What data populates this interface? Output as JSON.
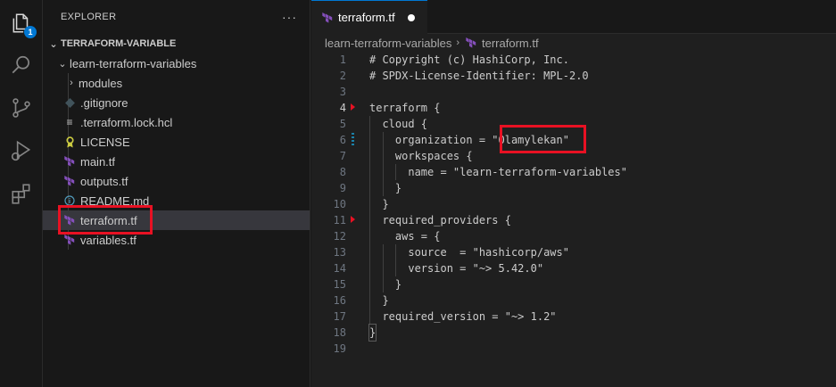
{
  "activity_bar": {
    "badge": "1",
    "icons": [
      "explorer-icon",
      "search-icon",
      "source-control-icon",
      "run-debug-icon",
      "extensions-icon"
    ]
  },
  "sidebar": {
    "title": "EXPLORER",
    "more": "···",
    "section": "TERRAFORM-VARIABLE",
    "folder": "learn-terraform-variables",
    "items": [
      {
        "label": "modules",
        "kind": "folder"
      },
      {
        "label": ".gitignore",
        "kind": "git"
      },
      {
        "label": ".terraform.lock.hcl",
        "kind": "lock"
      },
      {
        "label": "LICENSE",
        "kind": "license"
      },
      {
        "label": "main.tf",
        "kind": "terraform"
      },
      {
        "label": "outputs.tf",
        "kind": "terraform"
      },
      {
        "label": "README.md",
        "kind": "info"
      },
      {
        "label": "terraform.tf",
        "kind": "terraform"
      },
      {
        "label": "variables.tf",
        "kind": "terraform"
      }
    ]
  },
  "editor": {
    "tab_label": "terraform.tf",
    "breadcrumb": [
      "learn-terraform-variables",
      "terraform.tf"
    ],
    "active_line": "4",
    "lines": [
      {
        "n": "1",
        "text": "# Copyright (c) HashiCorp, Inc."
      },
      {
        "n": "2",
        "text": "# SPDX-License-Identifier: MPL-2.0"
      },
      {
        "n": "3",
        "text": ""
      },
      {
        "n": "4",
        "text": "terraform {"
      },
      {
        "n": "5",
        "text": "  cloud {"
      },
      {
        "n": "6",
        "text": "    organization = \"Olamylekan\""
      },
      {
        "n": "7",
        "text": "    workspaces {"
      },
      {
        "n": "8",
        "text": "      name = \"learn-terraform-variables\""
      },
      {
        "n": "9",
        "text": "    }"
      },
      {
        "n": "10",
        "text": "  }"
      },
      {
        "n": "11",
        "text": "  required_providers {"
      },
      {
        "n": "12",
        "text": "    aws = {"
      },
      {
        "n": "13",
        "text": "      source  = \"hashicorp/aws\""
      },
      {
        "n": "14",
        "text": "      version = \"~> 5.42.0\""
      },
      {
        "n": "15",
        "text": "    }"
      },
      {
        "n": "16",
        "text": "  }"
      },
      {
        "n": "17",
        "text": "  required_version = \"~> 1.2\""
      },
      {
        "n": "18",
        "text": "}"
      },
      {
        "n": "19",
        "text": ""
      }
    ]
  },
  "colors": {
    "accent": "#0078d4",
    "highlight": "#e81123",
    "terraform": "#844fba"
  }
}
